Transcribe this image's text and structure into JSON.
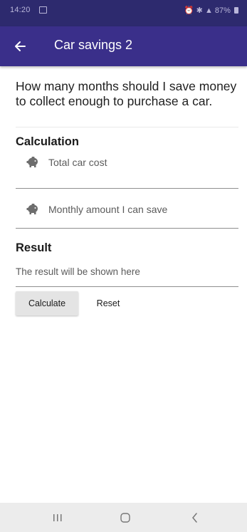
{
  "status_bar": {
    "time": "14:20",
    "right_text": "87%"
  },
  "app_bar": {
    "title": "Car savings 2"
  },
  "question": "How many months should I save money to collect enough to purchase a car.",
  "calculation": {
    "title": "Calculation",
    "fields": [
      {
        "placeholder": "Total car cost",
        "icon": "piggy-bank-icon"
      },
      {
        "placeholder": "Monthly amount I can save",
        "icon": "piggy-bank-icon"
      }
    ]
  },
  "result": {
    "title": "Result",
    "text": "The result will be shown here"
  },
  "buttons": {
    "calculate": "Calculate",
    "reset": "Reset"
  },
  "nav": {
    "recent": "recent-apps-icon",
    "home": "home-icon",
    "back": "back-icon"
  },
  "colors": {
    "status_bar": "#2d2a6e",
    "app_bar": "#3a2f8a",
    "button_bg": "#e4e4e4"
  }
}
